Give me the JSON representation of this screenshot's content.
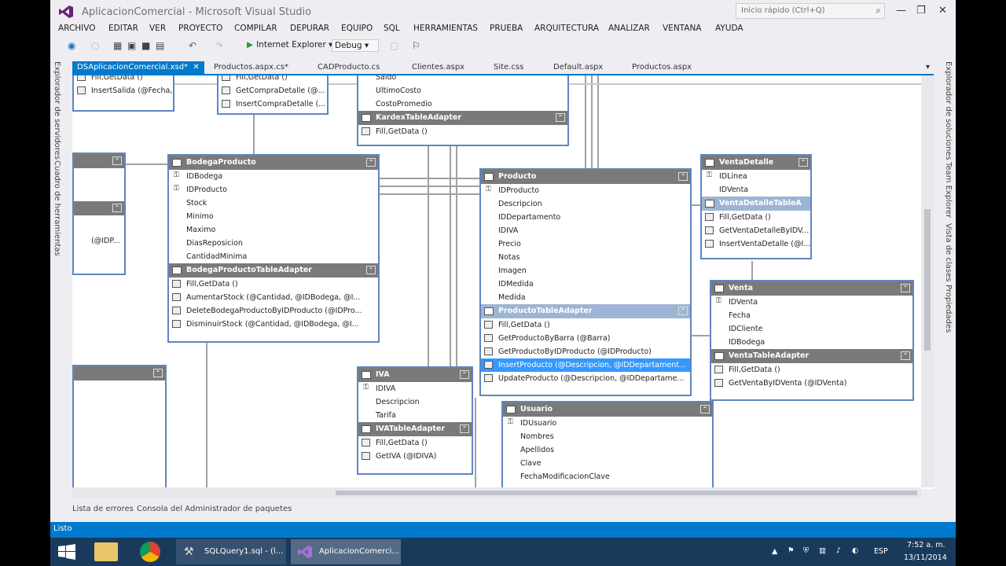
{
  "window": {
    "title": "AplicacionComercial - Microsoft Visual Studio",
    "quick_launch_placeholder": "Inicio rápido (Ctrl+Q)"
  },
  "menu": [
    "ARCHIVO",
    "EDITAR",
    "VER",
    "PROYECTO",
    "COMPILAR",
    "DEPURAR",
    "EQUIPO",
    "SQL",
    "HERRAMIENTAS",
    "PRUEBA",
    "ARQUITECTURA",
    "ANALIZAR",
    "VENTANA",
    "AYUDA"
  ],
  "toolbar": {
    "browser": "Internet Explorer",
    "configuration": "Debug"
  },
  "left_tool_tabs": [
    "Explorador de servidores",
    "Cuadro de herramientas"
  ],
  "right_tool_tabs": [
    "Explorador de soluciones",
    "Team Explorer",
    "Vista de clases",
    "Propiedades"
  ],
  "doc_tabs": [
    "DSAplicacionComercial.xsd*",
    "Productos.aspx.cs*",
    "CADProducto.cs",
    "Clientes.aspx",
    "Site.css",
    "Default.aspx",
    "Productos.aspx"
  ],
  "designer": {
    "tables": {
      "salida_partial": {
        "queries": [
          "Fill,GetData ()",
          "InsertSalida (@Fecha, ..."
        ]
      },
      "compra_partial": {
        "queries": [
          "Fill,GetData ()",
          "GetCompraDetalle (@...",
          "InsertCompraDetalle (..."
        ]
      },
      "kardex": {
        "columns": [
          "Saldo",
          "UltimoCosto",
          "CostoPromedio"
        ],
        "adapter": "KardexTableAdapter",
        "queries": [
          "Fill,GetData ()"
        ]
      },
      "left_partial": {
        "queries": [
          "(@IDP..."
        ]
      },
      "bodega": {
        "name": "BodegaProducto",
        "columns": [
          "IDBodega",
          "IDProducto",
          "Stock",
          "Minimo",
          "Maximo",
          "DiasReposicion",
          "CantidadMinima"
        ],
        "adapter": "BodegaProductoTableAdapter",
        "queries": [
          "Fill,GetData ()",
          "AumentarStock (@Cantidad, @IDBodega, @I...",
          "DeleteBodegaProductoByIDProducto (@IDPro...",
          "DisminuirStock (@Cantidad, @IDBodega, @I..."
        ]
      },
      "producto": {
        "name": "Producto",
        "columns": [
          "IDProducto",
          "Descripcion",
          "IDDepartamento",
          "IDIVA",
          "Precio",
          "Notas",
          "Imagen",
          "IDMedida",
          "Medida"
        ],
        "adapter": "ProductoTableAdapter",
        "queries": [
          "Fill,GetData ()",
          "GetProductoByBarra (@Barra)",
          "GetProductoByIDProducto (@IDProducto)",
          "InsertProducto (@Descripcion, @IDDepartament...",
          "UpdateProducto (@Descripcion, @IDDepartame..."
        ]
      },
      "ventadetalle": {
        "name": "VentaDetalle",
        "columns": [
          "IDLinea",
          "IDVenta"
        ],
        "adapter": "VentaDetalleTableA",
        "queries": [
          "Fill,GetData ()",
          "GetVentaDetalleByIDV...",
          "InsertVentaDetalle (@I..."
        ]
      },
      "venta": {
        "name": "Venta",
        "columns": [
          "IDVenta",
          "Fecha",
          "IDCliente",
          "IDBodega"
        ],
        "adapter": "VentaTableAdapter",
        "queries": [
          "Fill,GetData ()",
          "GetVentaByIDVenta (@IDVenta)"
        ]
      },
      "iva": {
        "name": "IVA",
        "columns": [
          "IDIVA",
          "Descripcion",
          "Tarifa"
        ],
        "adapter": "IVATableAdapter",
        "queries": [
          "Fill,GetData ()",
          "GetIVA (@IDIVA)"
        ]
      },
      "usuario": {
        "name": "Usuario",
        "columns": [
          "IDUsuario",
          "Nombres",
          "Apellidos",
          "Clave",
          "FechaModificacionClave"
        ]
      }
    }
  },
  "bottom_tabs": [
    "Lista de errores",
    "Consola del Administrador de paquetes"
  ],
  "status": "Listo",
  "taskbar": {
    "items": [
      "SQLQuery1.sql - (l...",
      "AplicacionComerci..."
    ],
    "language": "ESP",
    "time": "7:52 a. m.",
    "date": "13/11/2014"
  }
}
